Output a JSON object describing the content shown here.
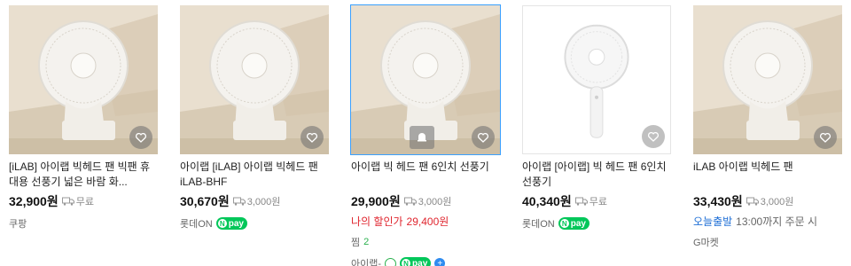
{
  "products": [
    {
      "title": "[iLAB] 아이랩 빅헤드 팬 빅팬 휴대용 선풍기 넓은 바람 화...",
      "price": "32,900원",
      "shipping": "무료",
      "seller": "쿠팡"
    },
    {
      "title": "아이랩 [iLAB] 아이랩 빅헤드 팬 iLAB-BHF",
      "price": "30,670원",
      "shipping": "3,000원",
      "seller": "롯데ON",
      "pay_label": "pay"
    },
    {
      "title": "아이랩 빅 헤드 팬 6인치 선풍기",
      "price": "29,900원",
      "shipping": "3,000원",
      "discount_label": "나의 할인가",
      "discount_price": "29,400원",
      "wish_label": "찜",
      "wish_count": "2",
      "seller": "아이랩-",
      "pay_label": "pay"
    },
    {
      "title": "아이랩 [아이랩] 빅 헤드 팬 6인치 선풍기",
      "price": "40,340원",
      "shipping": "무료",
      "seller": "롯데ON",
      "pay_label": "pay"
    },
    {
      "title": "iLAB 아이랩 빅헤드 팬",
      "price": "33,430원",
      "shipping": "3,000원",
      "delivery_label": "오늘출발",
      "delivery_note": "13:00까지 주문 시",
      "seller": "G마켓"
    }
  ],
  "colors": {
    "accent_blue": "#3aa0ff",
    "discount_red": "#e0262f",
    "npay_green": "#03c75a"
  }
}
